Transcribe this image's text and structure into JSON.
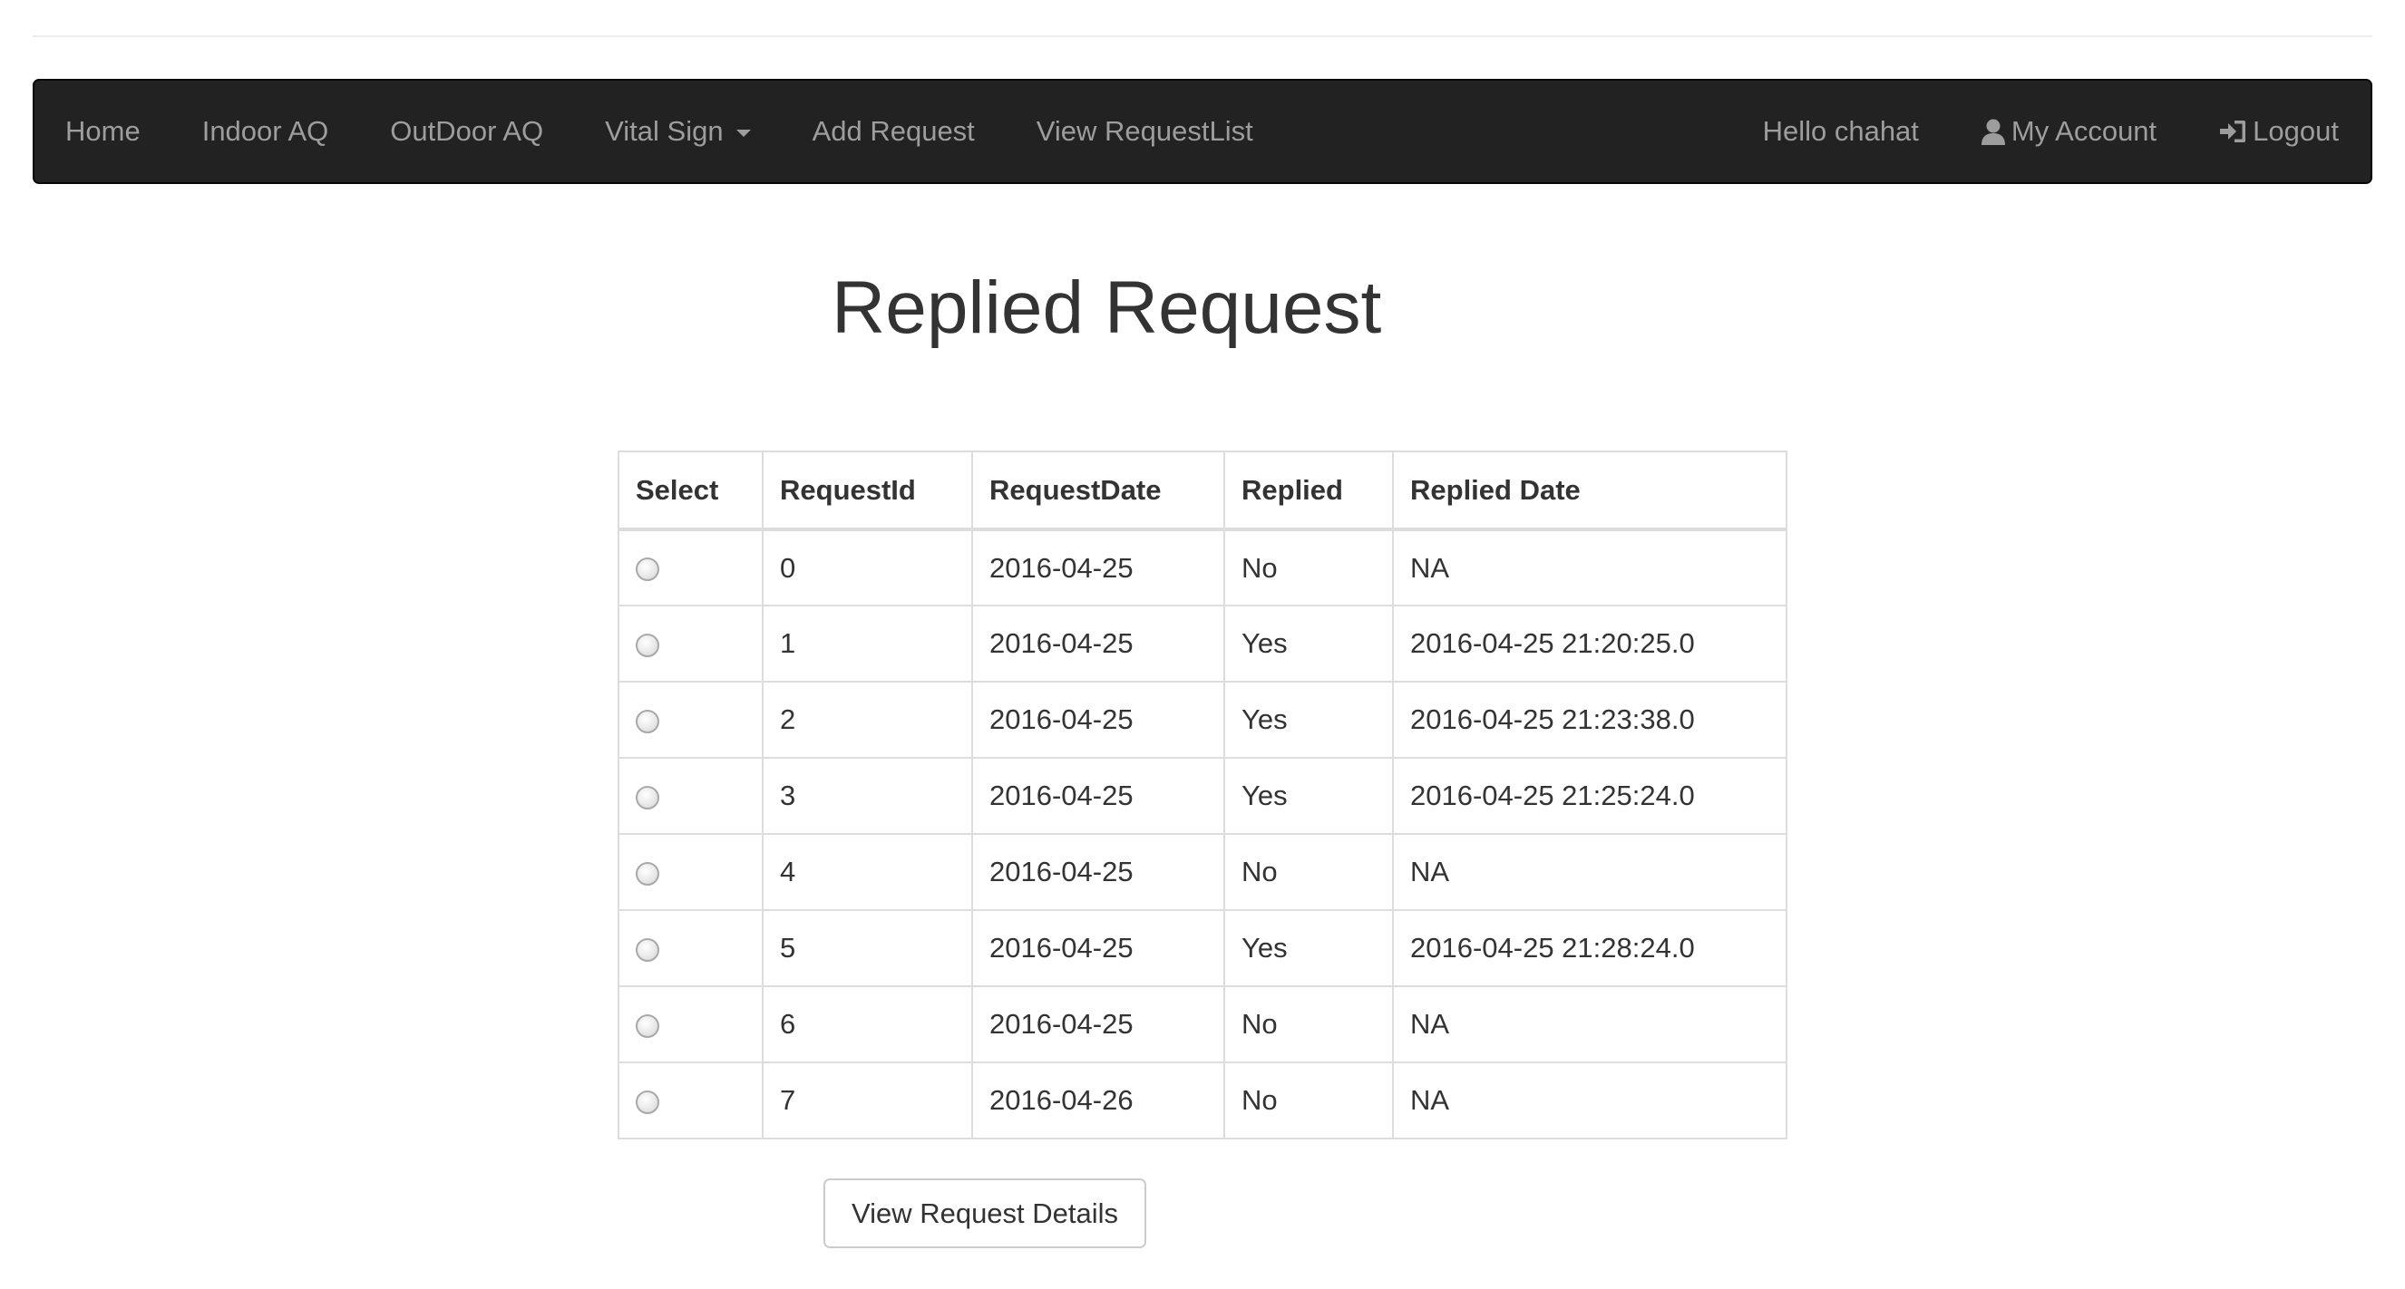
{
  "nav": {
    "left_items": [
      {
        "label": "Home"
      },
      {
        "label": "Indoor AQ"
      },
      {
        "label": "OutDoor AQ"
      },
      {
        "label": "Vital Sign"
      },
      {
        "label": "Add Request"
      },
      {
        "label": "View RequestList"
      }
    ],
    "greeting": "Hello chahat",
    "account_label": "My Account",
    "logout_label": "Logout",
    "icons": {
      "vital_sign": "caret-down-icon",
      "account": "user-icon",
      "logout": "log-in-icon"
    },
    "colors": {
      "background": "#222222",
      "text": "#9d9d9d"
    }
  },
  "page": {
    "title": "Replied Request"
  },
  "table": {
    "headers": [
      "Select",
      "RequestId",
      "RequestDate",
      "Replied",
      "Replied Date"
    ],
    "rows": [
      {
        "id": "0",
        "date": "2016-04-25",
        "replied": "No",
        "replied_date": "NA"
      },
      {
        "id": "1",
        "date": "2016-04-25",
        "replied": "Yes",
        "replied_date": "2016-04-25 21:20:25.0"
      },
      {
        "id": "2",
        "date": "2016-04-25",
        "replied": "Yes",
        "replied_date": "2016-04-25 21:23:38.0"
      },
      {
        "id": "3",
        "date": "2016-04-25",
        "replied": "Yes",
        "replied_date": "2016-04-25 21:25:24.0"
      },
      {
        "id": "4",
        "date": "2016-04-25",
        "replied": "No",
        "replied_date": "NA"
      },
      {
        "id": "5",
        "date": "2016-04-25",
        "replied": "Yes",
        "replied_date": "2016-04-25 21:28:24.0"
      },
      {
        "id": "6",
        "date": "2016-04-25",
        "replied": "No",
        "replied_date": "NA"
      },
      {
        "id": "7",
        "date": "2016-04-26",
        "replied": "No",
        "replied_date": "NA"
      }
    ]
  },
  "actions": {
    "view_details_label": "View Request Details"
  }
}
